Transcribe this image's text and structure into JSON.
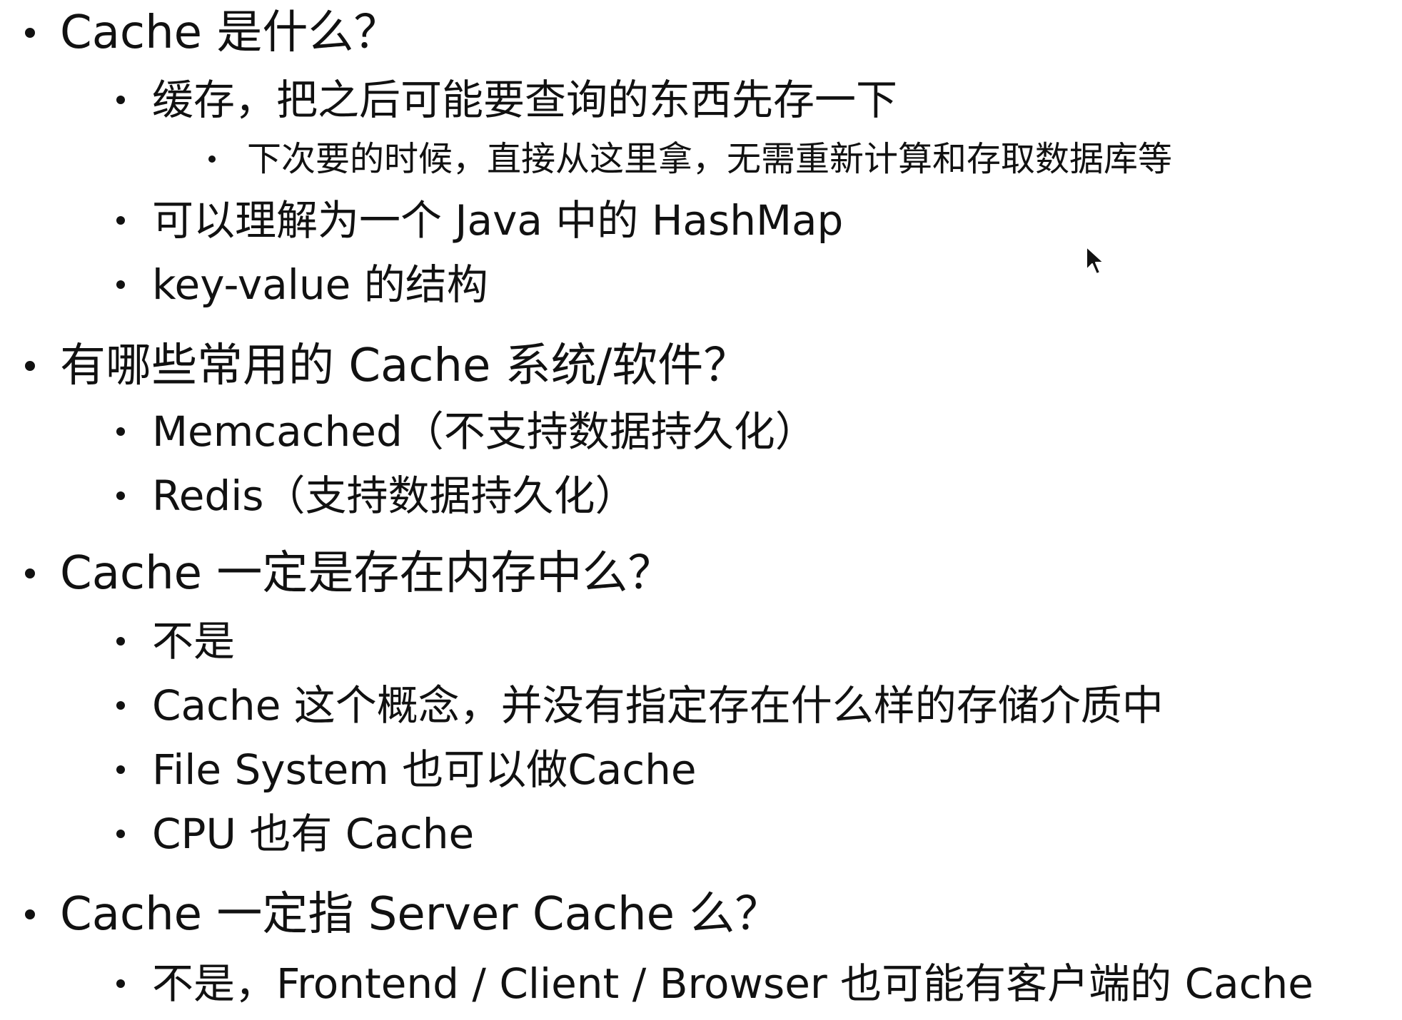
{
  "sections": [
    {
      "question": "Cache 是什么？",
      "items": [
        {
          "text": "缓存，把之后可能要查询的东西先存一下",
          "subitems": [
            "下次要的时候，直接从这里拿，无需重新计算和存取数据库等"
          ]
        },
        {
          "text": "可以理解为一个 Java 中的 HashMap"
        },
        {
          "text": "key-value 的结构"
        }
      ]
    },
    {
      "question": "有哪些常用的 Cache 系统/软件？",
      "items": [
        {
          "text": "Memcached（不支持数据持久化）"
        },
        {
          "text": "Redis（支持数据持久化）"
        }
      ]
    },
    {
      "question": "Cache 一定是存在内存中么？",
      "items": [
        {
          "text": "不是"
        },
        {
          "text": "Cache 这个概念，并没有指定存在什么样的存储介质中"
        },
        {
          "text": "File System 也可以做Cache"
        },
        {
          "text": "CPU 也有 Cache"
        }
      ]
    },
    {
      "question": "Cache 一定指 Server Cache 么？",
      "items": [
        {
          "text": "不是，Frontend / Client / Browser 也可能有客户端的 Cache"
        }
      ]
    }
  ],
  "cursor_icon": "mouse-pointer-icon"
}
